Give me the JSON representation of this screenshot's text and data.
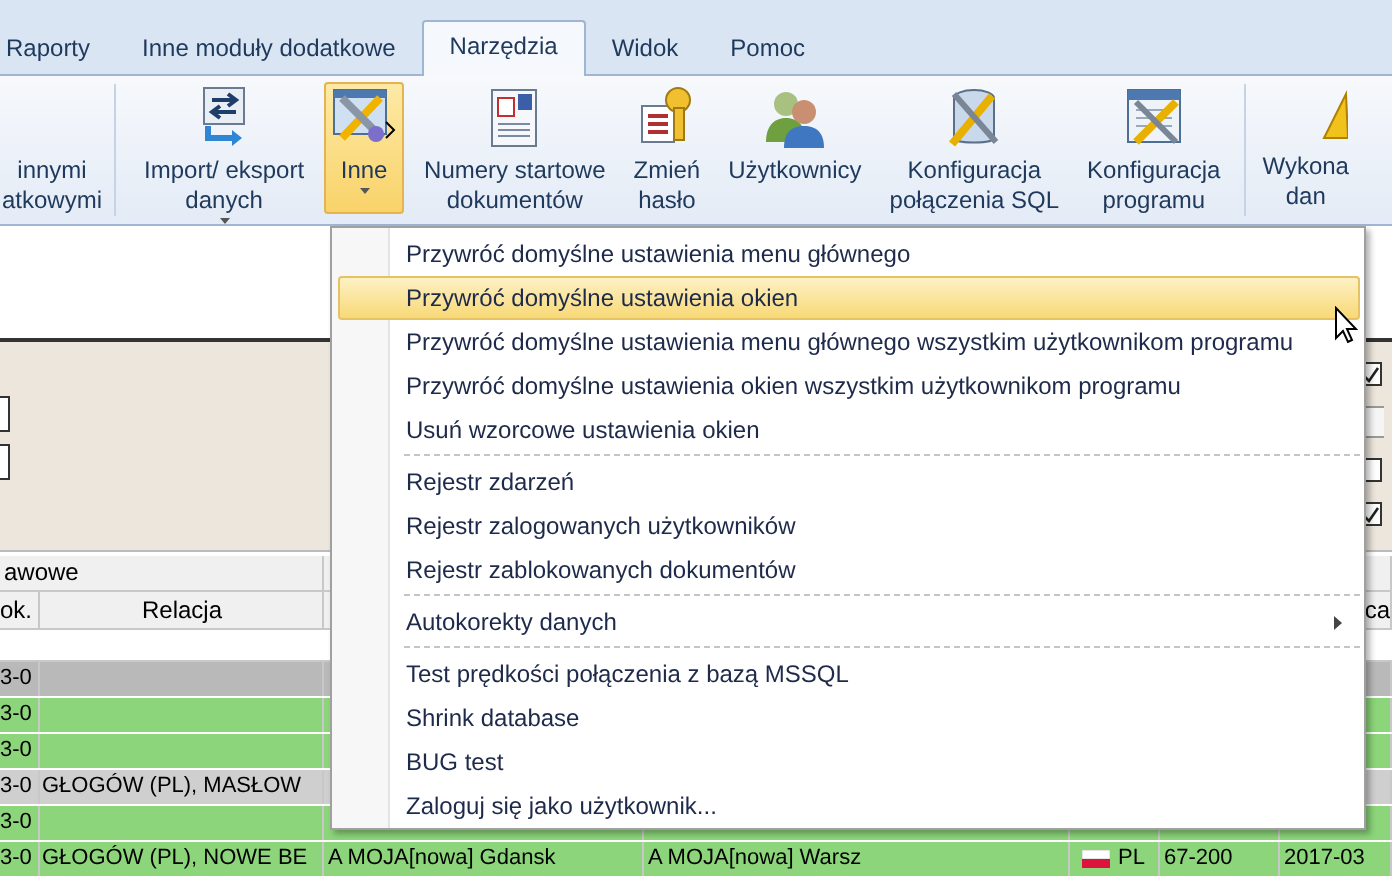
{
  "tabs": [
    {
      "label": "Raporty",
      "selected": false
    },
    {
      "label": "Inne moduły dodatkowe",
      "selected": false
    },
    {
      "label": "Narzędzia",
      "selected": true
    },
    {
      "label": "Widok",
      "selected": false
    },
    {
      "label": "Pomoc",
      "selected": false
    }
  ],
  "ribbon": {
    "groups": [
      {
        "buttons": [
          {
            "label": "innymi\natkowymi",
            "dropdown": false,
            "selected": false
          }
        ]
      },
      {
        "buttons": [
          {
            "label": "Import/ eksport\ndanych",
            "dropdown": true,
            "selected": false
          },
          {
            "label": "Inne",
            "dropdown": true,
            "selected": true
          },
          {
            "label": "Numery startowe\ndokumentów",
            "dropdown": false,
            "selected": false
          },
          {
            "label": "Zmień\nhasło",
            "dropdown": false,
            "selected": false
          },
          {
            "label": "Użytkownicy",
            "dropdown": false,
            "selected": false
          },
          {
            "label": "Konfiguracja\npołączenia SQL",
            "dropdown": false,
            "selected": false
          },
          {
            "label": "Konfiguracja\nprogramu",
            "dropdown": false,
            "selected": false
          }
        ]
      },
      {
        "buttons": [
          {
            "label": "Wykona\ndan",
            "dropdown": false,
            "selected": false
          }
        ]
      }
    ]
  },
  "filter_panel": {
    "checkboxes": [
      {
        "checked": true
      },
      {
        "checked": false
      },
      {
        "checked": true
      }
    ]
  },
  "grid": {
    "group_headers": [
      "awowe"
    ],
    "columns": [
      {
        "label": "ok."
      },
      {
        "label": "Relacja"
      },
      {},
      {},
      {},
      {},
      {
        "label": "ca"
      }
    ],
    "rows": [
      {
        "color": "#b9b9b9",
        "cells": [
          "3-0",
          null,
          null,
          null,
          null,
          null,
          null
        ]
      },
      {
        "color": "#8cd57a",
        "cells": [
          "3-0",
          null,
          null,
          null,
          null,
          null,
          null
        ]
      },
      {
        "color": "#8cd57a",
        "cells": [
          "3-0",
          null,
          null,
          null,
          null,
          null,
          null
        ]
      },
      {
        "color": "#cfcfcf",
        "cells": [
          "3-0",
          "GŁOGÓW (PL), MASŁOW",
          null,
          null,
          null,
          null,
          null
        ]
      },
      {
        "color": "#8cd57a",
        "cells": [
          "3-0",
          null,
          null,
          null,
          null,
          null,
          null
        ]
      },
      {
        "color": "#8cd57a",
        "cells": [
          "3-0",
          "GŁOGÓW (PL), NOWE BE",
          "A MOJA[nowa] Gdansk",
          "A MOJA[nowa] Warsz",
          "PL",
          "67-200",
          "2017-03"
        ]
      }
    ]
  },
  "menu": {
    "groups": [
      [
        {
          "label": "Przywróć domyślne ustawienia menu głównego",
          "selected": false,
          "submenu": false
        },
        {
          "label": "Przywróć domyślne ustawienia okien",
          "selected": true,
          "submenu": false
        },
        {
          "label": "Przywróć domyślne ustawienia menu głównego wszystkim użytkownikom programu",
          "selected": false,
          "submenu": false
        },
        {
          "label": "Przywróć domyślne ustawienia okien wszystkim użytkownikom programu",
          "selected": false,
          "submenu": false
        },
        {
          "label": "Usuń wzorcowe ustawienia okien",
          "selected": false,
          "submenu": false
        }
      ],
      [
        {
          "label": "Rejestr zdarzeń",
          "selected": false,
          "submenu": false
        },
        {
          "label": "Rejestr zalogowanych użytkowników",
          "selected": false,
          "submenu": false
        },
        {
          "label": "Rejestr zablokowanych dokumentów",
          "selected": false,
          "submenu": false
        }
      ],
      [
        {
          "label": "Autokorekty danych",
          "selected": false,
          "submenu": true
        }
      ],
      [
        {
          "label": "Test prędkości połączenia z bazą MSSQL",
          "selected": false,
          "submenu": false
        },
        {
          "label": "Shrink database",
          "selected": false,
          "submenu": false
        },
        {
          "label": "BUG test",
          "selected": false,
          "submenu": false
        },
        {
          "label": "Zaloguj się jako użytkownik...",
          "selected": false,
          "submenu": false
        }
      ]
    ]
  }
}
